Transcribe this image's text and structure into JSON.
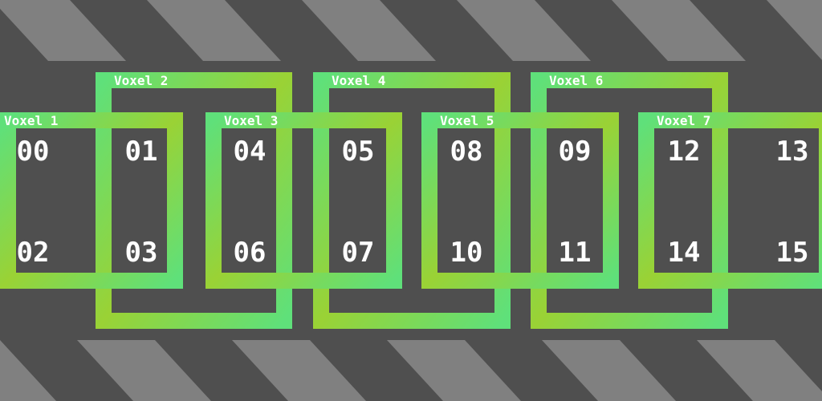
{
  "colors": {
    "background": "#4f4f4f",
    "stripe": "#808080",
    "voxel_gradient_edge": "#5fe07a",
    "voxel_gradient_mid": "#9ad235",
    "cell_fill": "#4f4f4f",
    "text": "#ffffff"
  },
  "cells": [
    {
      "top": "00",
      "bottom": "02"
    },
    {
      "top": "01",
      "bottom": "03"
    },
    {
      "top": "04",
      "bottom": "06"
    },
    {
      "top": "05",
      "bottom": "07"
    },
    {
      "top": "08",
      "bottom": "10"
    },
    {
      "top": "09",
      "bottom": "11"
    },
    {
      "top": "12",
      "bottom": "14"
    },
    {
      "top": "13",
      "bottom": "15"
    }
  ],
  "voxels": [
    {
      "label": "Voxel 1",
      "row": "inner"
    },
    {
      "label": "Voxel 2",
      "row": "outer"
    },
    {
      "label": "Voxel 3",
      "row": "inner"
    },
    {
      "label": "Voxel 4",
      "row": "outer"
    },
    {
      "label": "Voxel 5",
      "row": "inner"
    },
    {
      "label": "Voxel 6",
      "row": "outer"
    },
    {
      "label": "Voxel 7",
      "row": "inner"
    }
  ]
}
